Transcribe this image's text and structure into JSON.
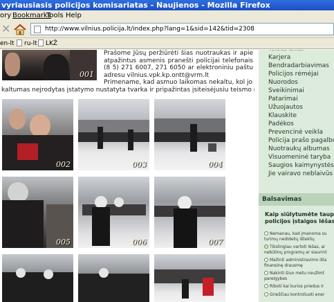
{
  "window": {
    "title": "vyriausiasis policijos komisariatas - Naujienos - Mozilla Firefox"
  },
  "menu": {
    "items": [
      "ory",
      "Bookmarks",
      "Tools",
      "Help"
    ]
  },
  "nav": {
    "url": "http://www.vilnius.policija.lt/index.php?lang=1&sid=142&tid=2308"
  },
  "bookmarks": {
    "items": [
      "en-lt",
      "ru-lt",
      "LKŽ"
    ]
  },
  "article": {
    "intro": "Prašome Jūsų peržiūrėti šias nuotraukas ir apie atpažintus asmenis pranešti policijai telefonais (8 5) 271 6007, 271 6050 ar elektroniniu paštu adresu vilnius.vpk.kp.ontt@vrm.lt",
    "intro_continued": "Primename, kad asmuo laikomas nekaltu, kol jo",
    "intro_line2": "kaltumas nejrodytas įstatymo nustatyta tvarka ir pripažintas įsiteisėjusiu teismo nuosprendžiu.",
    "photos": [
      {
        "caption": "001"
      },
      {
        "caption": "002"
      },
      {
        "caption": "003"
      },
      {
        "caption": "004"
      },
      {
        "caption": "005"
      },
      {
        "caption": "006"
      },
      {
        "caption": "007"
      },
      {
        "caption": ""
      },
      {
        "caption": ""
      },
      {
        "caption": ""
      }
    ]
  },
  "sidebar": {
    "nav_items": [
      "Karjera",
      "Bendradarbiavimas",
      "Policijos rėmėjai",
      "Nuorodos",
      "Sveikinimai",
      "Patarimai",
      "Užuojautos",
      "Klauskite",
      "Padėkos",
      "Prevencinė veikla",
      "Policija prašo pagalbos",
      "Nuotraukų albumas",
      "Visuomeninė taryba",
      "Saugios kaimynystės pro",
      "Jie vairavo neblaivūs"
    ],
    "poll": {
      "heading": "Balsavimas",
      "question_line1": "Kaip siūlytumėte taupyti V",
      "question_line2": "policijos įstaigos lėšas?",
      "options": [
        [
          "Nemanau, kad įmanoma su",
          "turimų nedidelių išteklių"
        ],
        [
          "Tikslingiau vartoti lėšas, ai",
          "nebūtinų programų ar siaurint"
        ],
        [
          "Mažinti administravimo išla",
          "finansinę drausmę"
        ],
        [
          "Nakinti šiuo metu neužimt",
          "pareigybes"
        ],
        [
          "Riboti kai kurios priedus ir"
        ],
        [
          "Griežčiau kontroliuoti ener"
        ]
      ]
    }
  }
}
